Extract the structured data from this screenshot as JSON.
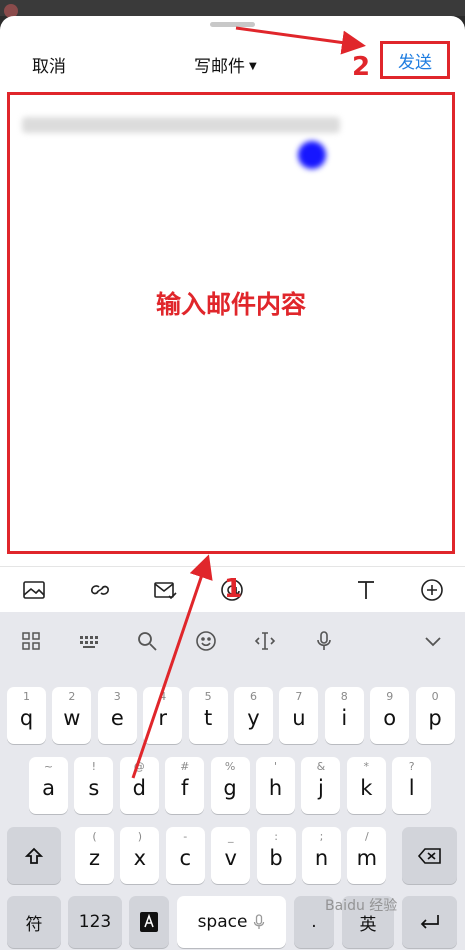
{
  "header": {
    "cancel_label": "取消",
    "title": "写邮件",
    "send_label": "发送"
  },
  "editor": {
    "hint": "输入邮件内容"
  },
  "annotations": {
    "step1": "1",
    "step2": "2"
  },
  "toolbar_icons": [
    "image-icon",
    "link-icon",
    "mail-check-icon",
    "at-icon",
    "text-format-icon",
    "add-icon"
  ],
  "keyboard": {
    "tools": [
      "grid-apps-icon",
      "keyboard-icon",
      "search-icon",
      "emoji-icon",
      "cursor-icon",
      "mic-icon",
      "collapse-icon"
    ],
    "row1": [
      {
        "hint": "1",
        "ch": "q"
      },
      {
        "hint": "2",
        "ch": "w"
      },
      {
        "hint": "3",
        "ch": "e"
      },
      {
        "hint": "4",
        "ch": "r"
      },
      {
        "hint": "5",
        "ch": "t"
      },
      {
        "hint": "6",
        "ch": "y"
      },
      {
        "hint": "7",
        "ch": "u"
      },
      {
        "hint": "8",
        "ch": "i"
      },
      {
        "hint": "9",
        "ch": "o"
      },
      {
        "hint": "0",
        "ch": "p"
      }
    ],
    "row2": [
      {
        "hint": "~",
        "ch": "a"
      },
      {
        "hint": "!",
        "ch": "s"
      },
      {
        "hint": "@",
        "ch": "d"
      },
      {
        "hint": "#",
        "ch": "f"
      },
      {
        "hint": "%",
        "ch": "g"
      },
      {
        "hint": "'",
        "ch": "h"
      },
      {
        "hint": "&",
        "ch": "j"
      },
      {
        "hint": "*",
        "ch": "k"
      },
      {
        "hint": "?",
        "ch": "l"
      }
    ],
    "row3": [
      {
        "hint": "(",
        "ch": "z"
      },
      {
        "hint": ")",
        "ch": "x"
      },
      {
        "hint": "-",
        "ch": "c"
      },
      {
        "hint": "_",
        "ch": "v"
      },
      {
        "hint": ":",
        "ch": "b"
      },
      {
        "hint": ";",
        "ch": "n"
      },
      {
        "hint": "/",
        "ch": "m"
      }
    ],
    "symbols_label": "符",
    "numbers_label": "123",
    "space_label": "space",
    "period_label": ".",
    "lang_label": "英"
  },
  "watermark": "Baidu 经验"
}
